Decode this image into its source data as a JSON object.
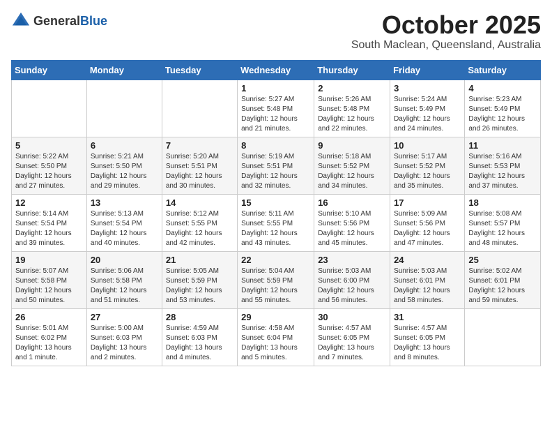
{
  "header": {
    "logo_general": "General",
    "logo_blue": "Blue",
    "title": "October 2025",
    "subtitle": "South Maclean, Queensland, Australia"
  },
  "weekdays": [
    "Sunday",
    "Monday",
    "Tuesday",
    "Wednesday",
    "Thursday",
    "Friday",
    "Saturday"
  ],
  "weeks": [
    [
      {
        "day": "",
        "info": ""
      },
      {
        "day": "",
        "info": ""
      },
      {
        "day": "",
        "info": ""
      },
      {
        "day": "1",
        "info": "Sunrise: 5:27 AM\nSunset: 5:48 PM\nDaylight: 12 hours\nand 21 minutes."
      },
      {
        "day": "2",
        "info": "Sunrise: 5:26 AM\nSunset: 5:48 PM\nDaylight: 12 hours\nand 22 minutes."
      },
      {
        "day": "3",
        "info": "Sunrise: 5:24 AM\nSunset: 5:49 PM\nDaylight: 12 hours\nand 24 minutes."
      },
      {
        "day": "4",
        "info": "Sunrise: 5:23 AM\nSunset: 5:49 PM\nDaylight: 12 hours\nand 26 minutes."
      }
    ],
    [
      {
        "day": "5",
        "info": "Sunrise: 5:22 AM\nSunset: 5:50 PM\nDaylight: 12 hours\nand 27 minutes."
      },
      {
        "day": "6",
        "info": "Sunrise: 5:21 AM\nSunset: 5:50 PM\nDaylight: 12 hours\nand 29 minutes."
      },
      {
        "day": "7",
        "info": "Sunrise: 5:20 AM\nSunset: 5:51 PM\nDaylight: 12 hours\nand 30 minutes."
      },
      {
        "day": "8",
        "info": "Sunrise: 5:19 AM\nSunset: 5:51 PM\nDaylight: 12 hours\nand 32 minutes."
      },
      {
        "day": "9",
        "info": "Sunrise: 5:18 AM\nSunset: 5:52 PM\nDaylight: 12 hours\nand 34 minutes."
      },
      {
        "day": "10",
        "info": "Sunrise: 5:17 AM\nSunset: 5:52 PM\nDaylight: 12 hours\nand 35 minutes."
      },
      {
        "day": "11",
        "info": "Sunrise: 5:16 AM\nSunset: 5:53 PM\nDaylight: 12 hours\nand 37 minutes."
      }
    ],
    [
      {
        "day": "12",
        "info": "Sunrise: 5:14 AM\nSunset: 5:54 PM\nDaylight: 12 hours\nand 39 minutes."
      },
      {
        "day": "13",
        "info": "Sunrise: 5:13 AM\nSunset: 5:54 PM\nDaylight: 12 hours\nand 40 minutes."
      },
      {
        "day": "14",
        "info": "Sunrise: 5:12 AM\nSunset: 5:55 PM\nDaylight: 12 hours\nand 42 minutes."
      },
      {
        "day": "15",
        "info": "Sunrise: 5:11 AM\nSunset: 5:55 PM\nDaylight: 12 hours\nand 43 minutes."
      },
      {
        "day": "16",
        "info": "Sunrise: 5:10 AM\nSunset: 5:56 PM\nDaylight: 12 hours\nand 45 minutes."
      },
      {
        "day": "17",
        "info": "Sunrise: 5:09 AM\nSunset: 5:56 PM\nDaylight: 12 hours\nand 47 minutes."
      },
      {
        "day": "18",
        "info": "Sunrise: 5:08 AM\nSunset: 5:57 PM\nDaylight: 12 hours\nand 48 minutes."
      }
    ],
    [
      {
        "day": "19",
        "info": "Sunrise: 5:07 AM\nSunset: 5:58 PM\nDaylight: 12 hours\nand 50 minutes."
      },
      {
        "day": "20",
        "info": "Sunrise: 5:06 AM\nSunset: 5:58 PM\nDaylight: 12 hours\nand 51 minutes."
      },
      {
        "day": "21",
        "info": "Sunrise: 5:05 AM\nSunset: 5:59 PM\nDaylight: 12 hours\nand 53 minutes."
      },
      {
        "day": "22",
        "info": "Sunrise: 5:04 AM\nSunset: 5:59 PM\nDaylight: 12 hours\nand 55 minutes."
      },
      {
        "day": "23",
        "info": "Sunrise: 5:03 AM\nSunset: 6:00 PM\nDaylight: 12 hours\nand 56 minutes."
      },
      {
        "day": "24",
        "info": "Sunrise: 5:03 AM\nSunset: 6:01 PM\nDaylight: 12 hours\nand 58 minutes."
      },
      {
        "day": "25",
        "info": "Sunrise: 5:02 AM\nSunset: 6:01 PM\nDaylight: 12 hours\nand 59 minutes."
      }
    ],
    [
      {
        "day": "26",
        "info": "Sunrise: 5:01 AM\nSunset: 6:02 PM\nDaylight: 13 hours\nand 1 minute."
      },
      {
        "day": "27",
        "info": "Sunrise: 5:00 AM\nSunset: 6:03 PM\nDaylight: 13 hours\nand 2 minutes."
      },
      {
        "day": "28",
        "info": "Sunrise: 4:59 AM\nSunset: 6:03 PM\nDaylight: 13 hours\nand 4 minutes."
      },
      {
        "day": "29",
        "info": "Sunrise: 4:58 AM\nSunset: 6:04 PM\nDaylight: 13 hours\nand 5 minutes."
      },
      {
        "day": "30",
        "info": "Sunrise: 4:57 AM\nSunset: 6:05 PM\nDaylight: 13 hours\nand 7 minutes."
      },
      {
        "day": "31",
        "info": "Sunrise: 4:57 AM\nSunset: 6:05 PM\nDaylight: 13 hours\nand 8 minutes."
      },
      {
        "day": "",
        "info": ""
      }
    ]
  ]
}
